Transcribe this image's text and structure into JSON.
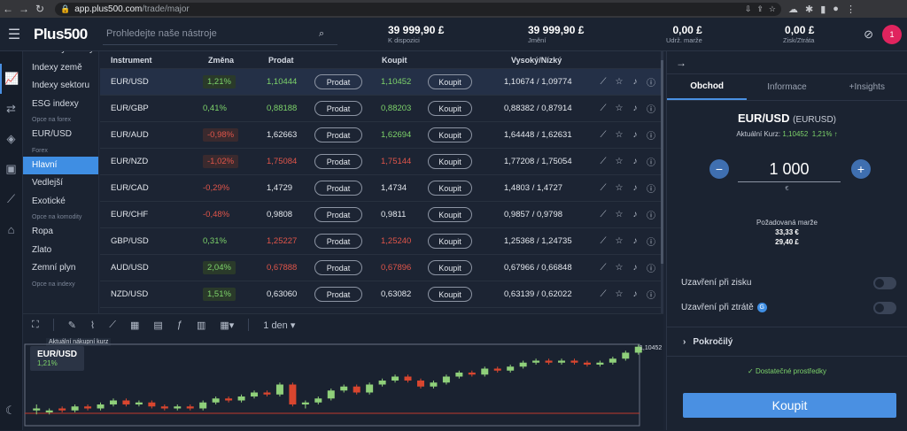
{
  "browser": {
    "url_host": "app.plus500.com",
    "url_path": "/trade/major"
  },
  "header": {
    "logo": "Plus500",
    "search_placeholder": "Prohledejte naše nástroje",
    "stats": [
      {
        "value": "39 999,90 £",
        "label": "K dispozici"
      },
      {
        "value": "39 999,90 £",
        "label": "Jmění"
      },
      {
        "value": "0,00 £",
        "label": "Udrž. marže"
      },
      {
        "value": "0,00 £",
        "label": "Zisk/Ztráta"
      }
    ],
    "avatar": "1"
  },
  "categories": [
    {
      "label": "Všechny indexy",
      "type": "item"
    },
    {
      "label": "Indexy země",
      "type": "item"
    },
    {
      "label": "Indexy sektoru",
      "type": "item"
    },
    {
      "label": "ESG indexy",
      "type": "item"
    },
    {
      "label": "Opce na forex",
      "type": "section"
    },
    {
      "label": "EUR/USD",
      "type": "item"
    },
    {
      "label": "Forex",
      "type": "section"
    },
    {
      "label": "Hlavní",
      "type": "active"
    },
    {
      "label": "Vedlejší",
      "type": "item"
    },
    {
      "label": "Exotické",
      "type": "item"
    },
    {
      "label": "Opce na komodity",
      "type": "section"
    },
    {
      "label": "Ropa",
      "type": "item"
    },
    {
      "label": "Zlato",
      "type": "item"
    },
    {
      "label": "Zemní plyn",
      "type": "item"
    },
    {
      "label": "Opce na indexy",
      "type": "section"
    }
  ],
  "table": {
    "headers": {
      "instrument": "Instrument",
      "change": "Změna",
      "sell": "Prodat",
      "buy": "Koupit",
      "highlow": "Vysoký/Nízký"
    },
    "sell_label": "Prodat",
    "buy_label": "Koupit",
    "rows": [
      {
        "instrument": "EUR/USD",
        "change": "1,21%",
        "dir": "up",
        "badge": true,
        "sell": "1,10444",
        "sellc": "g",
        "buy": "1,10452",
        "buyc": "g",
        "highlow": "1,10674 / 1,09774"
      },
      {
        "instrument": "EUR/GBP",
        "change": "0,41%",
        "dir": "up",
        "badge": false,
        "sell": "0,88188",
        "sellc": "g",
        "buy": "0,88203",
        "buyc": "g",
        "highlow": "0,88382 / 0,87914"
      },
      {
        "instrument": "EUR/AUD",
        "change": "-0,98%",
        "dir": "down",
        "badge": true,
        "sell": "1,62663",
        "sellc": "w",
        "buy": "1,62694",
        "buyc": "g",
        "highlow": "1,64448 / 1,62631"
      },
      {
        "instrument": "EUR/NZD",
        "change": "-1,02%",
        "dir": "down",
        "badge": true,
        "sell": "1,75084",
        "sellc": "r",
        "buy": "1,75144",
        "buyc": "r",
        "highlow": "1,77208 / 1,75054"
      },
      {
        "instrument": "EUR/CAD",
        "change": "-0,29%",
        "dir": "down",
        "badge": false,
        "sell": "1,4729",
        "sellc": "w",
        "buy": "1,4734",
        "buyc": "w",
        "highlow": "1,4803 / 1,4727"
      },
      {
        "instrument": "EUR/CHF",
        "change": "-0,48%",
        "dir": "down",
        "badge": false,
        "sell": "0,9808",
        "sellc": "w",
        "buy": "0,9811",
        "buyc": "w",
        "highlow": "0,9857 / 0,9798"
      },
      {
        "instrument": "GBP/USD",
        "change": "0,31%",
        "dir": "up",
        "badge": false,
        "sell": "1,25227",
        "sellc": "r",
        "buy": "1,25240",
        "buyc": "r",
        "highlow": "1,25368 / 1,24735"
      },
      {
        "instrument": "AUD/USD",
        "change": "2,04%",
        "dir": "up",
        "badge": true,
        "sell": "0,67888",
        "sellc": "r",
        "buy": "0,67896",
        "buyc": "r",
        "highlow": "0,67966 / 0,66848"
      },
      {
        "instrument": "NZD/USD",
        "change": "1,51%",
        "dir": "up",
        "badge": true,
        "sell": "0,63060",
        "sellc": "w",
        "buy": "0,63082",
        "buyc": "w",
        "highlow": "0,63139 / 0,62022"
      }
    ]
  },
  "chart_toolbar": {
    "period": "1 den"
  },
  "chart": {
    "series_label": "Aktuální nákupní kurz",
    "instrument": "EUR/USD",
    "change": "1,21%",
    "last_price": "1,10452",
    "candles": [
      [
        5,
        6,
        3,
        8
      ],
      [
        4,
        5,
        3,
        6
      ],
      [
        6,
        5,
        4,
        7
      ],
      [
        5,
        7,
        4,
        8
      ],
      [
        7,
        6,
        5,
        8
      ],
      [
        6,
        8,
        5,
        9
      ],
      [
        8,
        10,
        7,
        11
      ],
      [
        10,
        8,
        7,
        11
      ],
      [
        8,
        9,
        7,
        10
      ],
      [
        9,
        7,
        6,
        10
      ],
      [
        7,
        6,
        5,
        8
      ],
      [
        6,
        7,
        5,
        8
      ],
      [
        7,
        6,
        5,
        8
      ],
      [
        6,
        9,
        5,
        10
      ],
      [
        9,
        11,
        8,
        12
      ],
      [
        11,
        10,
        9,
        12
      ],
      [
        10,
        12,
        9,
        13
      ],
      [
        12,
        14,
        11,
        15
      ],
      [
        14,
        13,
        12,
        15
      ],
      [
        13,
        18,
        12,
        19
      ],
      [
        18,
        8,
        7,
        19
      ],
      [
        8,
        9,
        6,
        10
      ],
      [
        9,
        11,
        8,
        12
      ],
      [
        11,
        15,
        10,
        16
      ],
      [
        15,
        17,
        14,
        18
      ],
      [
        17,
        14,
        13,
        18
      ],
      [
        14,
        18,
        13,
        19
      ],
      [
        18,
        20,
        17,
        21
      ],
      [
        20,
        22,
        19,
        23
      ],
      [
        22,
        20,
        19,
        23
      ],
      [
        20,
        17,
        16,
        21
      ],
      [
        17,
        19,
        16,
        20
      ],
      [
        19,
        22,
        18,
        23
      ],
      [
        22,
        24,
        21,
        25
      ],
      [
        24,
        23,
        22,
        25
      ],
      [
        23,
        26,
        22,
        27
      ],
      [
        26,
        25,
        24,
        27
      ],
      [
        25,
        27,
        24,
        28
      ],
      [
        27,
        29,
        26,
        30
      ],
      [
        29,
        30,
        28,
        31
      ],
      [
        30,
        29,
        28,
        31
      ],
      [
        29,
        30,
        28,
        31
      ],
      [
        30,
        29,
        28,
        31
      ],
      [
        29,
        28,
        27,
        30
      ],
      [
        28,
        29,
        27,
        30
      ],
      [
        29,
        31,
        28,
        32
      ],
      [
        31,
        34,
        30,
        35
      ],
      [
        34,
        37,
        33,
        38
      ]
    ]
  },
  "order_panel": {
    "tabs": [
      "Obchod",
      "Informace",
      "+Insights"
    ],
    "instrument": "EUR/USD",
    "instrument_code": "(EURUSD)",
    "rate_label": "Aktuální Kurz:",
    "rate_value": "1,10452",
    "rate_change": "1,21% ↑",
    "quantity": "1 000",
    "quantity_unit": "€",
    "margin_label": "Požadovaná marže",
    "margin_value_1": "33,33 €",
    "margin_value_2": "29,40 £",
    "take_profit": "Uzavření při zisku",
    "stop_loss": "Uzavření při ztrátě",
    "advanced": "Pokročilý",
    "funds": "Dostatečné prostředky",
    "buy_button": "Koupit"
  }
}
